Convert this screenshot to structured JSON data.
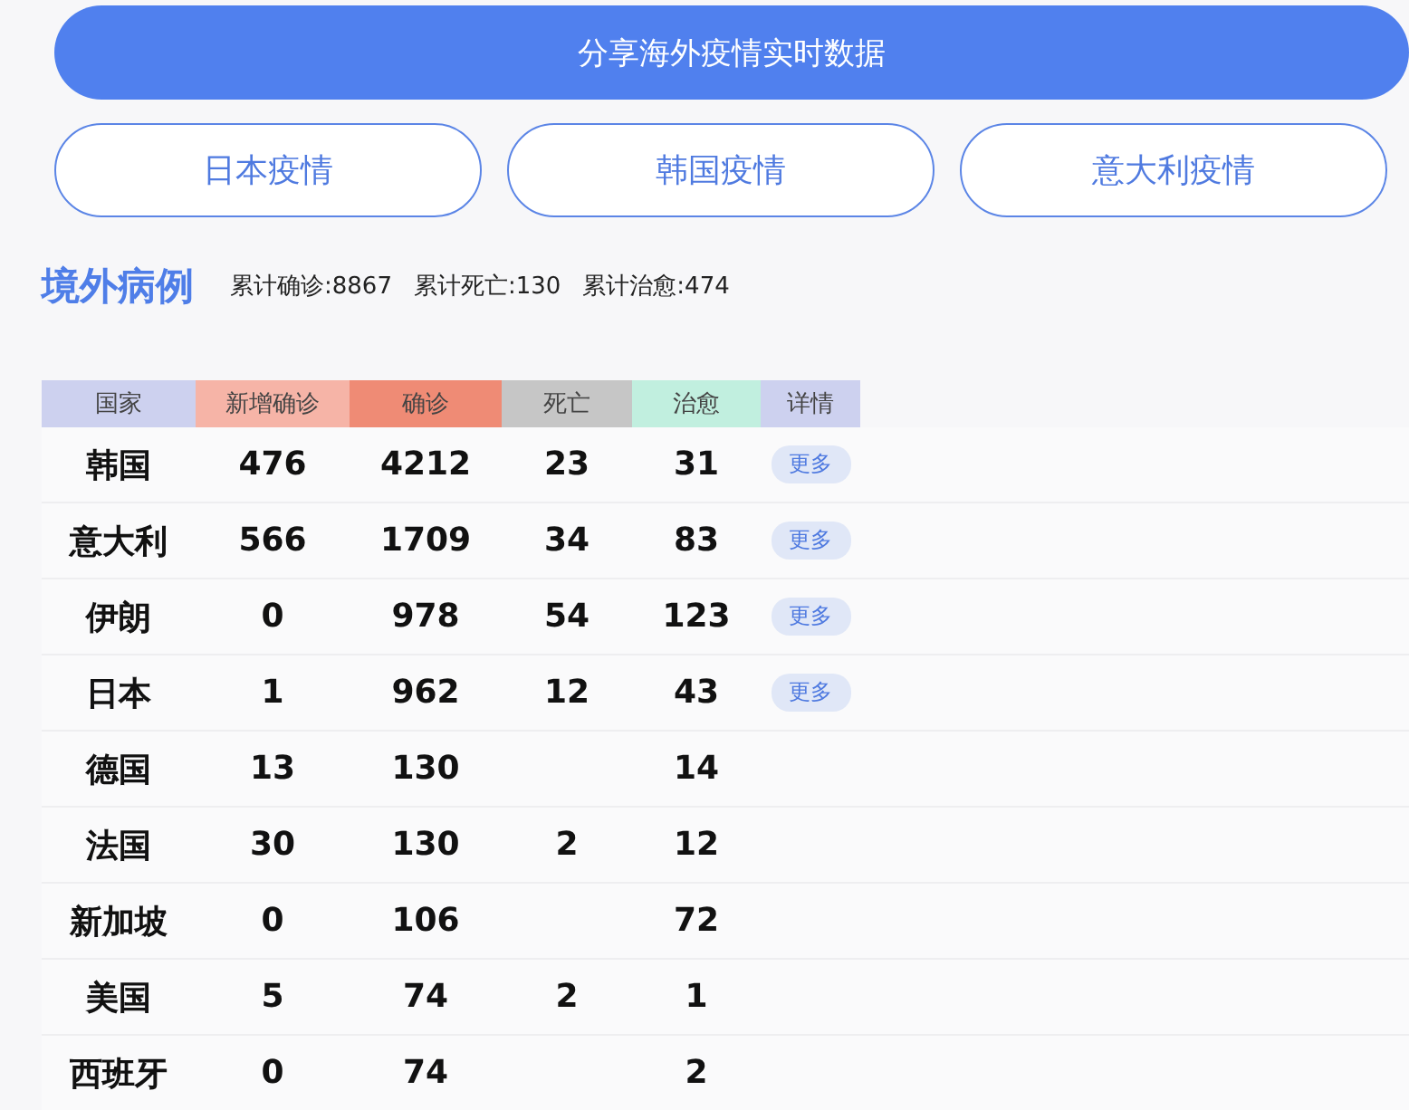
{
  "share_button": "分享海外疫情实时数据",
  "region_tabs": [
    "日本疫情",
    "韩国疫情",
    "意大利疫情"
  ],
  "section": {
    "title": "境外病例",
    "stats": [
      "累计确诊:8867",
      "累计死亡:130",
      "累计治愈:474"
    ]
  },
  "table": {
    "columns": [
      {
        "label": "国家",
        "color": "#cdd1ef"
      },
      {
        "label": "新增确诊",
        "color": "#f6b4a7"
      },
      {
        "label": "确诊",
        "color": "#ef8b75"
      },
      {
        "label": "死亡",
        "color": "#c6c6c6"
      },
      {
        "label": "治愈",
        "color": "#c1efdf"
      },
      {
        "label": "详情",
        "color": "#cdd1ef"
      }
    ],
    "rows": [
      {
        "cells": [
          "韩国",
          "476",
          "4212",
          "23",
          "31"
        ],
        "more": "更多"
      },
      {
        "cells": [
          "意大利",
          "566",
          "1709",
          "34",
          "83"
        ],
        "more": "更多"
      },
      {
        "cells": [
          "伊朗",
          "0",
          "978",
          "54",
          "123"
        ],
        "more": "更多"
      },
      {
        "cells": [
          "日本",
          "1",
          "962",
          "12",
          "43"
        ],
        "more": "更多"
      },
      {
        "cells": [
          "德国",
          "13",
          "130",
          null,
          "14"
        ]
      },
      {
        "cells": [
          "法国",
          "30",
          "130",
          "2",
          "12"
        ]
      },
      {
        "cells": [
          "新加坡",
          "0",
          "106",
          null,
          "72"
        ]
      },
      {
        "cells": [
          "美国",
          "5",
          "74",
          "2",
          "1"
        ]
      },
      {
        "cells": [
          "西班牙",
          "0",
          "74",
          null,
          "2"
        ]
      }
    ]
  }
}
